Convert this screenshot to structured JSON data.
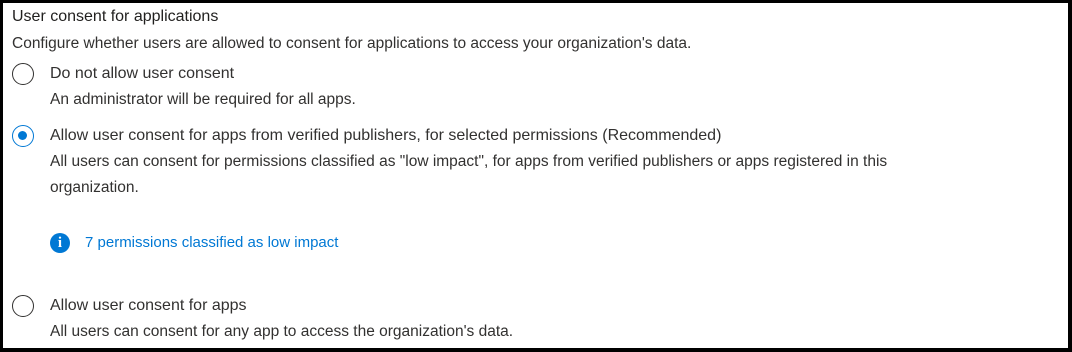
{
  "section": {
    "title": "User consent for applications",
    "description": "Configure whether users are allowed to consent for applications to access your organization's data."
  },
  "options": [
    {
      "label": "Do not allow user consent",
      "sublabel": "An administrator will be required for all apps.",
      "selected": false
    },
    {
      "label": "Allow user consent for apps from verified publishers, for selected permissions (Recommended)",
      "sublabel_line1": "All users can consent for permissions classified as \"low impact\", for apps from verified publishers or apps registered in this",
      "sublabel_line2": "organization.",
      "selected": true
    },
    {
      "label": "Allow user consent for apps",
      "sublabel": "All users can consent for any app to access the organization's data.",
      "selected": false
    }
  ],
  "info_link": {
    "icon": "info-icon",
    "text": "7 permissions classified as low impact"
  },
  "colors": {
    "accent": "#0078d4",
    "text": "#323130"
  }
}
